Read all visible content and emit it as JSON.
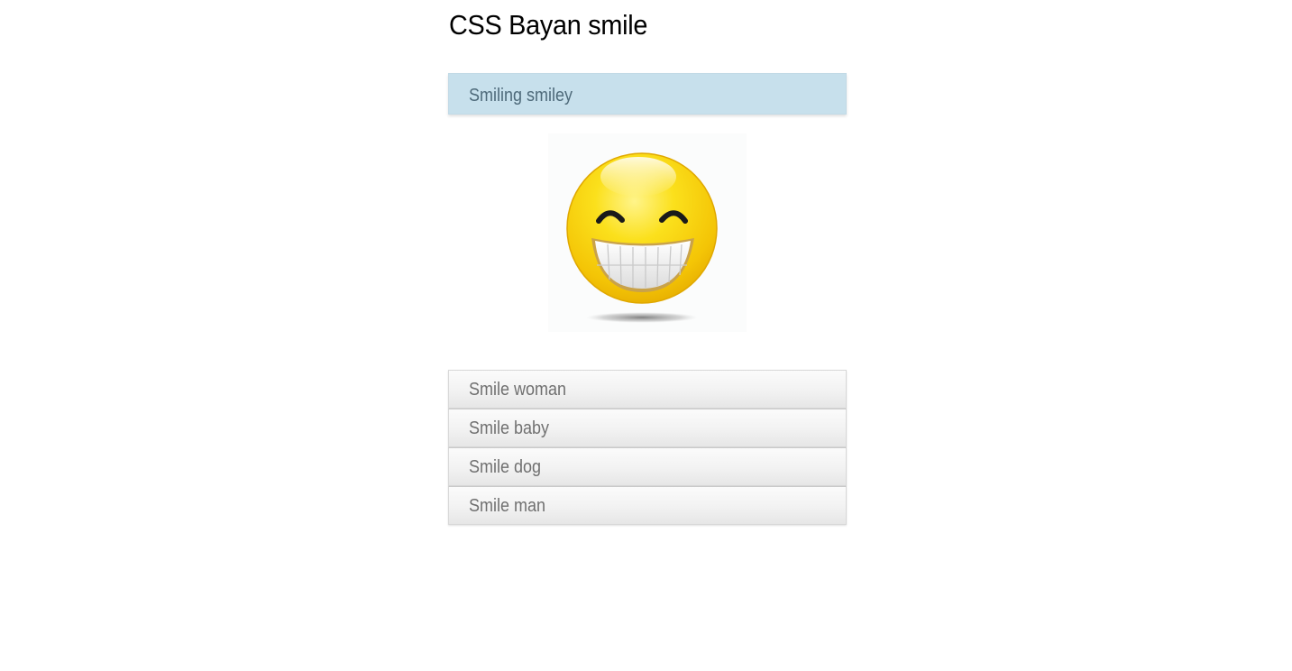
{
  "page": {
    "title": "CSS Bayan smile"
  },
  "accordion": {
    "active": {
      "label": "Smiling smiley",
      "image": "grinning-smiley-face"
    },
    "items": [
      {
        "label": "Smile woman"
      },
      {
        "label": "Smile baby"
      },
      {
        "label": "Smile dog"
      },
      {
        "label": "Smile man"
      }
    ]
  },
  "colors": {
    "active_header_bg": "#c7e0ec",
    "active_header_text": "#4e6a7a",
    "header_text": "#707070",
    "smiley_yellow": "#f7cf0a"
  }
}
